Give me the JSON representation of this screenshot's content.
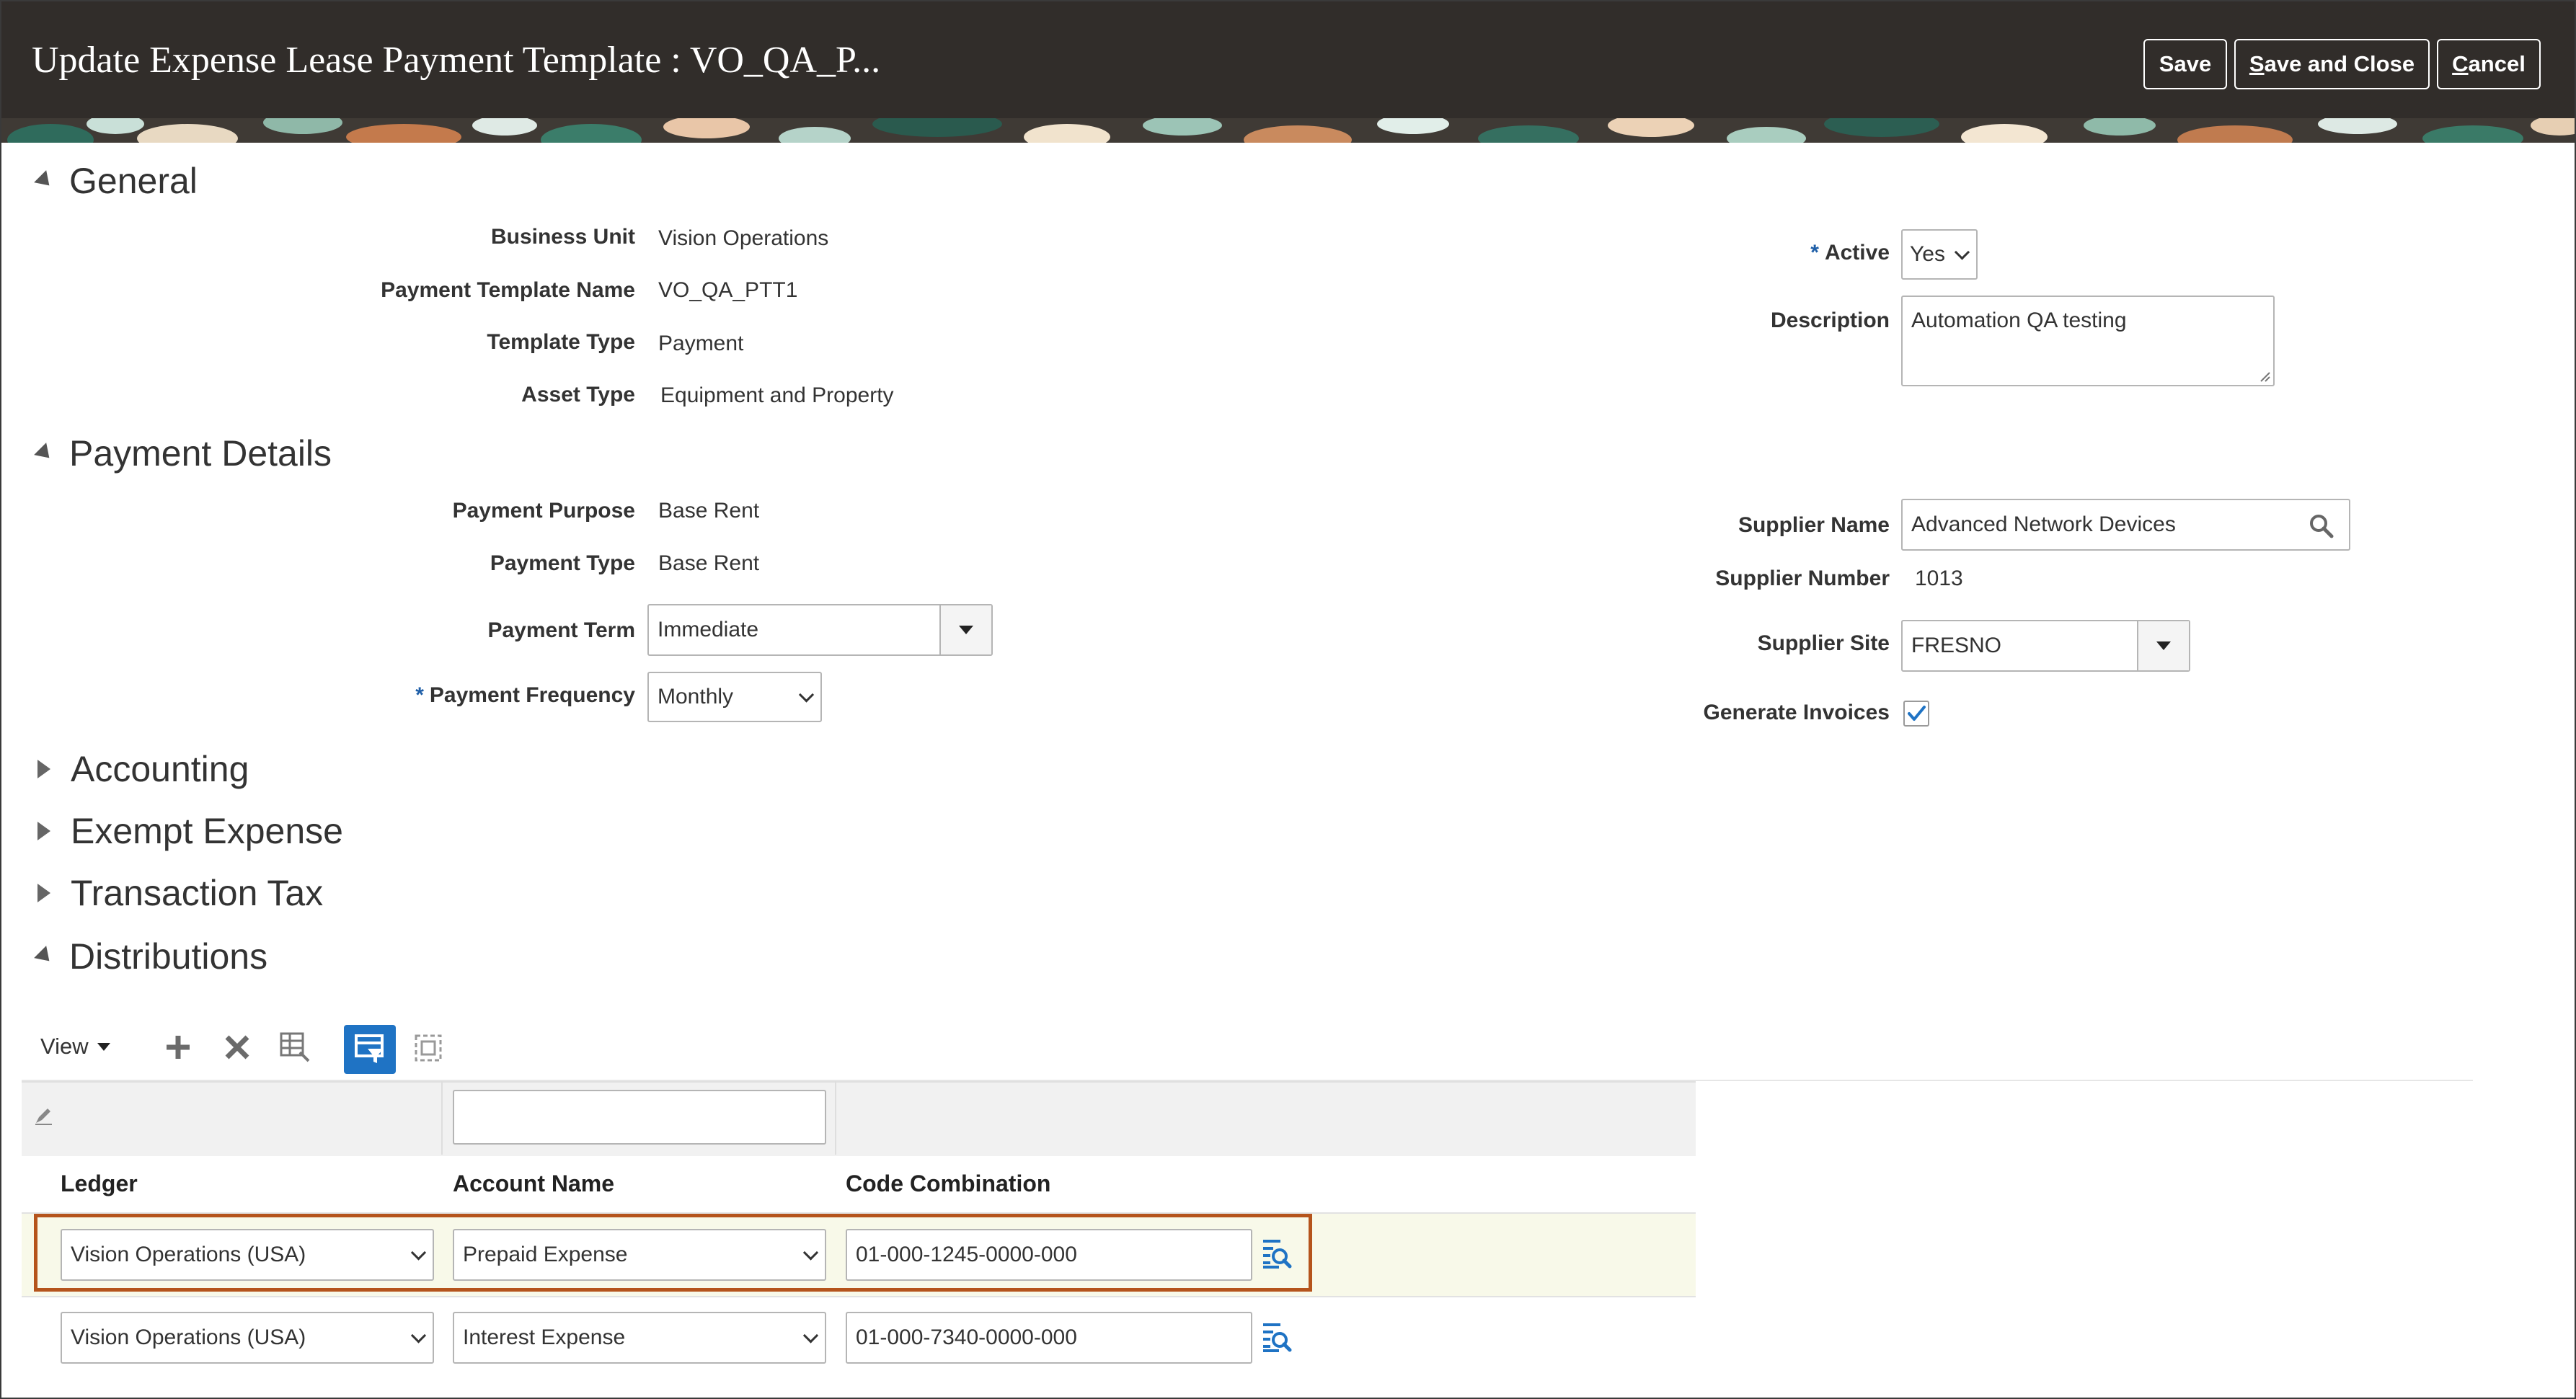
{
  "header": {
    "title": "Update Expense Lease Payment Template : VO_QA_P...",
    "save_label": "Save",
    "save_close_prefix": "S",
    "save_close_rest": "ave and Close",
    "cancel_prefix": "C",
    "cancel_rest": "ancel"
  },
  "sections": {
    "general": "General",
    "payment_details": "Payment Details",
    "accounting": "Accounting",
    "exempt_expense": "Exempt Expense",
    "transaction_tax": "Transaction Tax",
    "distributions": "Distributions"
  },
  "general": {
    "business_unit_label": "Business Unit",
    "business_unit_value": "Vision Operations",
    "template_name_label": "Payment Template Name",
    "template_name_value": "VO_QA_PTT1",
    "template_type_label": "Template Type",
    "template_type_value": "Payment",
    "asset_type_label": "Asset Type",
    "asset_type_value": "Equipment and Property",
    "active_label": "Active",
    "active_required": "*",
    "active_value": "Yes",
    "description_label": "Description",
    "description_value": "Automation QA testing"
  },
  "payment_details": {
    "purpose_label": "Payment Purpose",
    "purpose_value": "Base Rent",
    "type_label": "Payment Type",
    "type_value": "Base Rent",
    "term_label": "Payment Term",
    "term_value": "Immediate",
    "frequency_label": "Payment Frequency",
    "frequency_required": "*",
    "frequency_value": "Monthly",
    "supplier_name_label": "Supplier Name",
    "supplier_name_value": "Advanced Network Devices",
    "supplier_number_label": "Supplier Number",
    "supplier_number_value": "1013",
    "supplier_site_label": "Supplier Site",
    "supplier_site_value": "FRESNO",
    "generate_invoices_label": "Generate Invoices",
    "generate_invoices_checked": true
  },
  "distributions": {
    "view_label": "View",
    "columns": [
      "Ledger",
      "Account Name",
      "Code Combination"
    ],
    "filter_value": "",
    "rows": [
      {
        "ledger": "Vision Operations (USA)",
        "account": "Prepaid Expense",
        "code": "01-000-1245-0000-000"
      },
      {
        "ledger": "Vision Operations (USA)",
        "account": "Interest Expense",
        "code": "01-000-7340-0000-000"
      }
    ]
  },
  "colors": {
    "header_bg": "#312d2a",
    "required_star": "#1f5fa8",
    "highlight_border": "#b5541c",
    "selected_row_bg": "#f8f9e9",
    "toolbar_active": "#1f73c4"
  }
}
